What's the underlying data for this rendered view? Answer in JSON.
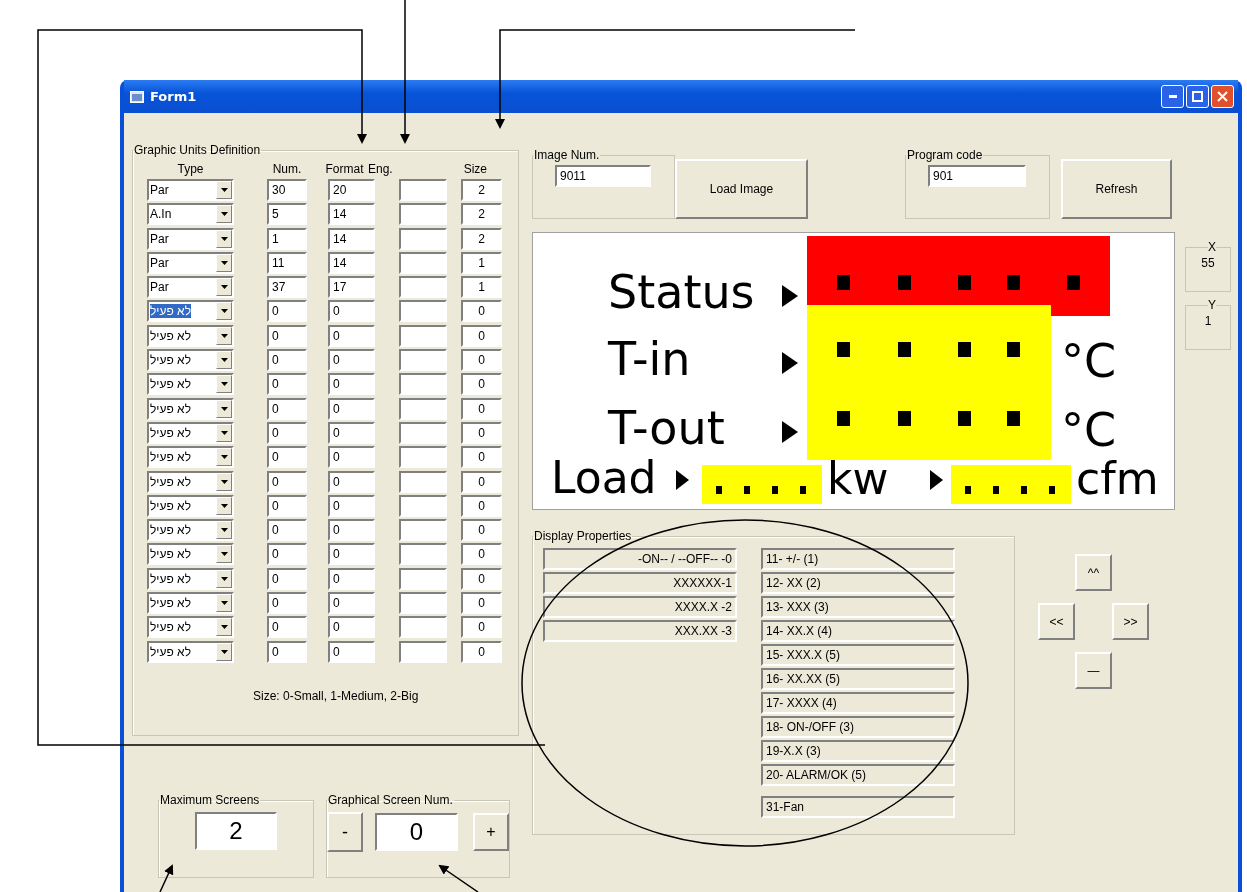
{
  "window": {
    "title": "Form1"
  },
  "units": {
    "title": "Graphic Units Definition",
    "headers": [
      "Type",
      "Num.",
      "Format",
      "Eng.",
      "Size"
    ],
    "rows": [
      {
        "type": "Par",
        "selected": false,
        "num": "30",
        "format": "20",
        "size": "2"
      },
      {
        "type": "A.In",
        "selected": false,
        "num": "5",
        "format": "14",
        "size": "2"
      },
      {
        "type": "Par",
        "selected": false,
        "num": "1",
        "format": "14",
        "size": "2"
      },
      {
        "type": "Par",
        "selected": false,
        "num": "11",
        "format": "14",
        "size": "1"
      },
      {
        "type": "Par",
        "selected": false,
        "num": "37",
        "format": "17",
        "size": "1"
      },
      {
        "type": "לא פעיל",
        "selected": true,
        "num": "0",
        "format": "0",
        "size": "0"
      },
      {
        "type": "לא פעיל",
        "selected": false,
        "num": "0",
        "format": "0",
        "size": "0"
      },
      {
        "type": "לא פעיל",
        "selected": false,
        "num": "0",
        "format": "0",
        "size": "0"
      },
      {
        "type": "לא פעיל",
        "selected": false,
        "num": "0",
        "format": "0",
        "size": "0"
      },
      {
        "type": "לא פעיל",
        "selected": false,
        "num": "0",
        "format": "0",
        "size": "0"
      },
      {
        "type": "לא פעיל",
        "selected": false,
        "num": "0",
        "format": "0",
        "size": "0"
      },
      {
        "type": "לא פעיל",
        "selected": false,
        "num": "0",
        "format": "0",
        "size": "0"
      },
      {
        "type": "לא פעיל",
        "selected": false,
        "num": "0",
        "format": "0",
        "size": "0"
      },
      {
        "type": "לא פעיל",
        "selected": false,
        "num": "0",
        "format": "0",
        "size": "0"
      },
      {
        "type": "לא פעיל",
        "selected": false,
        "num": "0",
        "format": "0",
        "size": "0"
      },
      {
        "type": "לא פעיל",
        "selected": false,
        "num": "0",
        "format": "0",
        "size": "0"
      },
      {
        "type": "לא פעיל",
        "selected": false,
        "num": "0",
        "format": "0",
        "size": "0"
      },
      {
        "type": "לא פעיל",
        "selected": false,
        "num": "0",
        "format": "0",
        "size": "0"
      },
      {
        "type": "לא פעיל",
        "selected": false,
        "num": "0",
        "format": "0",
        "size": "0"
      },
      {
        "type": "לא פעיל",
        "selected": false,
        "num": "0",
        "format": "0",
        "size": "0"
      }
    ],
    "note": "Size: 0-Small, 1-Medium, 2-Big"
  },
  "image_num": {
    "label": "Image Num.",
    "value": "9011"
  },
  "load_button": "Load Image",
  "program_code": {
    "label": "Program code",
    "value": "901"
  },
  "refresh_button": "Refresh",
  "display": {
    "rows": [
      {
        "label": "Status",
        "color": "#ff0000"
      },
      {
        "label": "T-in",
        "color": "#ffff00",
        "unit": "°C"
      },
      {
        "label": "T-out",
        "color": "#ffff00",
        "unit": "°C"
      }
    ],
    "load": {
      "label": "Load",
      "color": "#ffff00",
      "unit_1": "kw",
      "unit_2": "cfm"
    }
  },
  "coords": [
    {
      "label": "X",
      "value": "55"
    },
    {
      "label": "Y",
      "value": "1"
    }
  ],
  "display_properties": {
    "title": "Display Properties",
    "left": [
      "-ON-- / --OFF-- -0",
      "XXXXXX-1",
      "XXXX.X -2",
      "XXX.XX -3"
    ],
    "right": [
      "11- +/- (1)",
      "12- XX (2)",
      "13- XXX (3)",
      "14- XX.X (4)",
      "15- XXX.X (5)",
      "16- XX.XX (5)",
      "17- XXXX (4)",
      "18- ON-/OFF (3)",
      "19-X.X (3)",
      "20- ALARM/OK (5)"
    ],
    "extra": "31-Fan"
  },
  "nav_buttons": [
    "^^",
    "<<",
    ">>",
    "—"
  ],
  "max_screens": {
    "label": "Maximum Screens",
    "value": "2"
  },
  "screen_num": {
    "label": "Graphical Screen Num.",
    "minus": "-",
    "value": "0",
    "plus": "+"
  }
}
